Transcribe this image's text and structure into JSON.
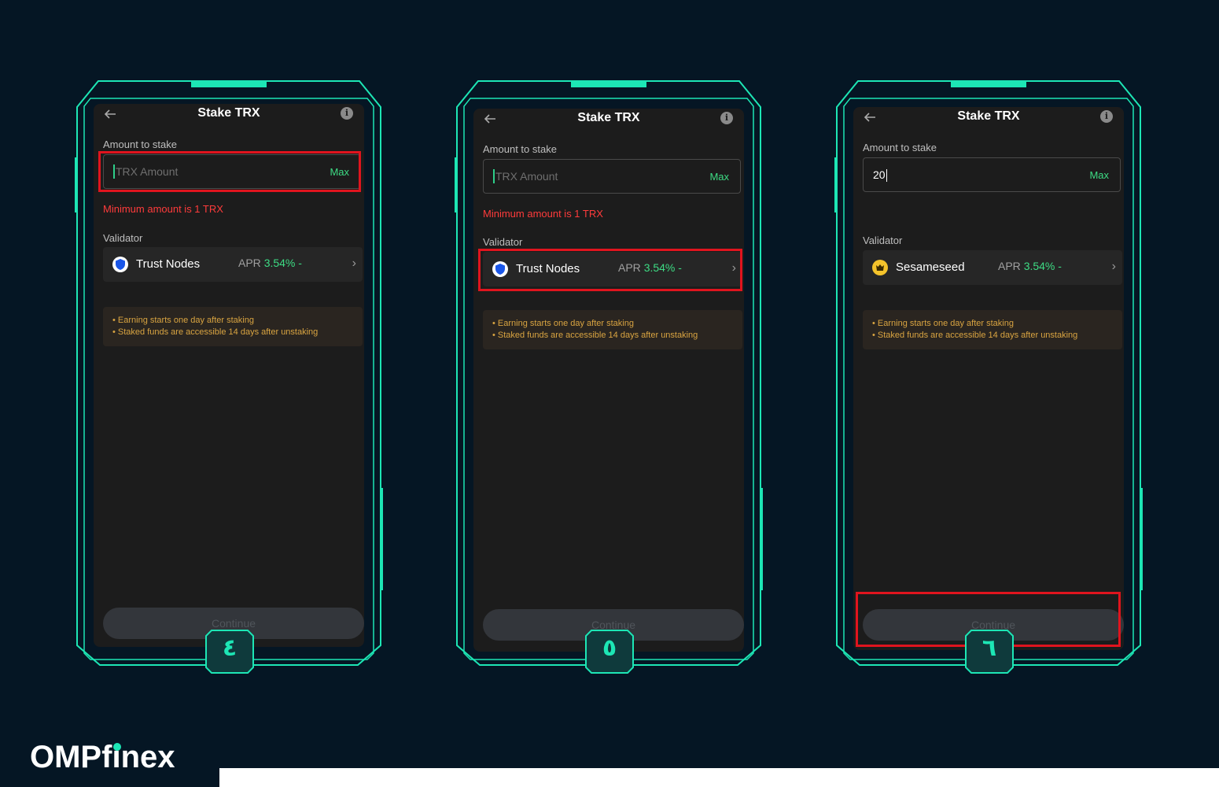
{
  "screens": [
    {
      "title": "Stake TRX",
      "amount_label": "Amount to stake",
      "amount_placeholder": "TRX Amount",
      "amount_value": "",
      "max_label": "Max",
      "error": "Minimum amount is 1 TRX",
      "validator_label": "Validator",
      "validator_name": "Trust Nodes",
      "validator_icon": "shield-icon",
      "apr_label": "APR",
      "apr_value": "3.54% -",
      "notice_1": "• Earning starts one day after staking",
      "notice_2": "• Staked funds are accessible 14 days after unstaking",
      "continue_label": "Continue",
      "step": "٤",
      "highlight": "amount-field"
    },
    {
      "title": "Stake TRX",
      "amount_label": "Amount to stake",
      "amount_placeholder": "TRX Amount",
      "amount_value": "",
      "max_label": "Max",
      "error": "Minimum amount is 1 TRX",
      "validator_label": "Validator",
      "validator_name": "Trust Nodes",
      "validator_icon": "shield-icon",
      "apr_label": "APR",
      "apr_value": "3.54% -",
      "notice_1": "• Earning starts one day after staking",
      "notice_2": "• Staked funds are accessible 14 days after unstaking",
      "continue_label": "Continue",
      "step": "٥",
      "highlight": "validator-card"
    },
    {
      "title": "Stake TRX",
      "amount_label": "Amount to stake",
      "amount_placeholder": "",
      "amount_value": "20",
      "max_label": "Max",
      "error": "",
      "validator_label": "Validator",
      "validator_name": "Sesameseed",
      "validator_icon": "sesame-icon",
      "apr_label": "APR",
      "apr_value": "3.54% -",
      "notice_1": "• Earning starts one day after staking",
      "notice_2": "• Staked funds are accessible 14 days after unstaking",
      "continue_label": "Continue",
      "step": "٦",
      "highlight": "continue-button"
    }
  ],
  "brand": {
    "logo_text_1": "OMPf",
    "logo_text_i": "ı",
    "logo_text_2": "nex"
  },
  "colors": {
    "background": "#051624",
    "frame": "#1de6b5",
    "accent_green": "#3ddc84",
    "error_red": "#ff3b3b",
    "highlight_red": "#e0141e",
    "notice_text": "#d9a441"
  }
}
